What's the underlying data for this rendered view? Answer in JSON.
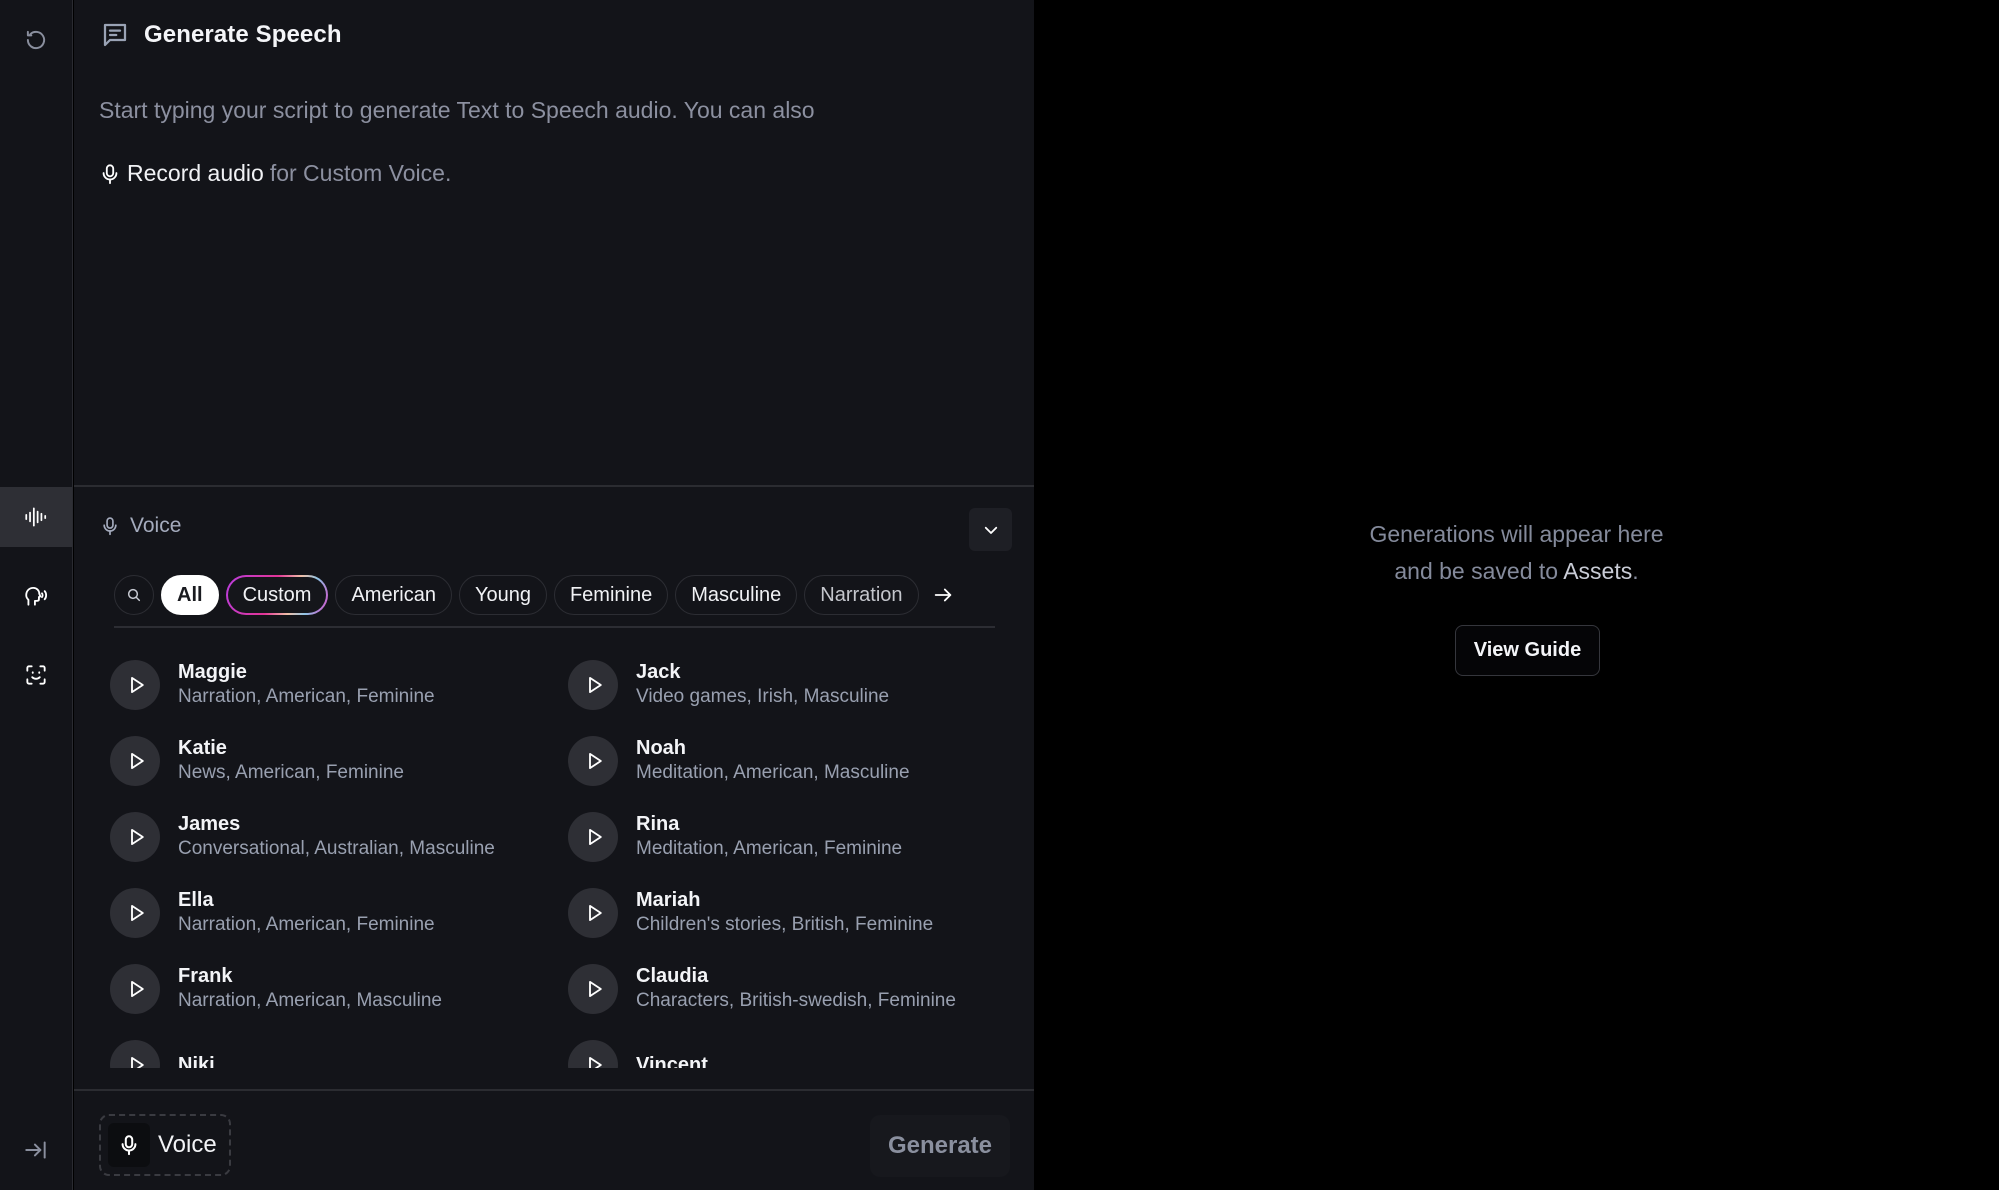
{
  "sidebar": {
    "items": [
      {
        "name": "history",
        "icon": "history-icon"
      },
      {
        "name": "text-to-speech",
        "icon": "waveform-icon",
        "active": true
      },
      {
        "name": "voice-changer",
        "icon": "speaking-head-icon"
      },
      {
        "name": "face-scan",
        "icon": "face-scan-icon"
      }
    ],
    "collapse_icon": "expand-sidebar-icon"
  },
  "header": {
    "title": "Generate Speech",
    "icon": "message-icon"
  },
  "editor": {
    "placeholder": "Start typing your script to generate Text to Speech audio. You can also",
    "record_link": "Record audio",
    "record_rest": "for Custom Voice."
  },
  "voice_panel": {
    "title": "Voice",
    "filters": [
      {
        "label": "All",
        "state": "selected"
      },
      {
        "label": "Custom",
        "state": "highlighted"
      },
      {
        "label": "American"
      },
      {
        "label": "Young"
      },
      {
        "label": "Feminine"
      },
      {
        "label": "Masculine"
      },
      {
        "label": "Narration"
      }
    ],
    "voices": [
      {
        "name": "Maggie",
        "tags": "Narration, American, Feminine"
      },
      {
        "name": "Jack",
        "tags": "Video games, Irish, Masculine"
      },
      {
        "name": "Katie",
        "tags": "News, American, Feminine"
      },
      {
        "name": "Noah",
        "tags": "Meditation, American, Masculine"
      },
      {
        "name": "James",
        "tags": "Conversational, Australian, Masculine"
      },
      {
        "name": "Rina",
        "tags": "Meditation, American, Feminine"
      },
      {
        "name": "Ella",
        "tags": "Narration, American, Feminine"
      },
      {
        "name": "Mariah",
        "tags": "Children's stories, British, Feminine"
      },
      {
        "name": "Frank",
        "tags": "Narration, American, Masculine"
      },
      {
        "name": "Claudia",
        "tags": "Characters, British-swedish, Feminine"
      },
      {
        "name": "Niki",
        "tags": ""
      },
      {
        "name": "Vincent",
        "tags": ""
      }
    ]
  },
  "footer": {
    "voice_button": "Voice",
    "generate_button": "Generate"
  },
  "output": {
    "line1": "Generations will appear here",
    "line2_prefix": "and be saved to",
    "line2_accent": "Assets",
    "line2_suffix": ".",
    "guide_button": "View Guide"
  }
}
